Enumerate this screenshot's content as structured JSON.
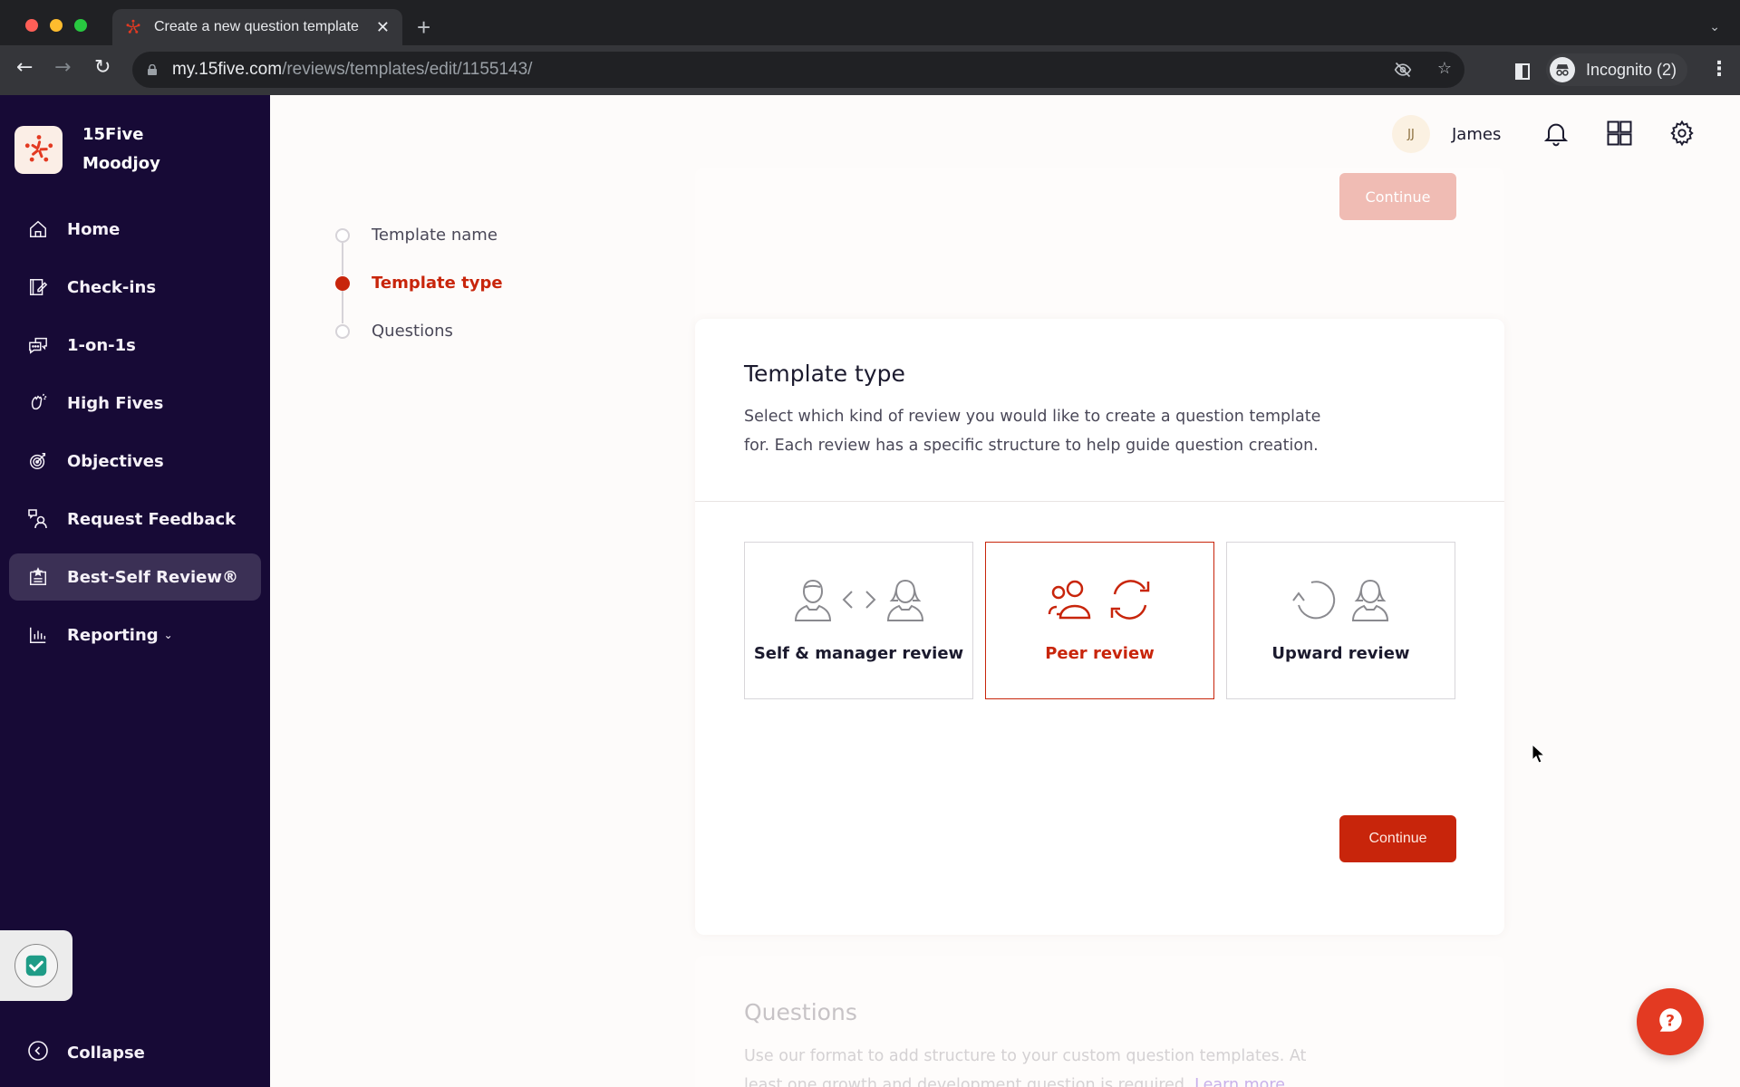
{
  "browser": {
    "tab_title": "Create a new question template",
    "url_host": "my.15five.com",
    "url_path": "/reviews/templates/edit/1155143/",
    "incognito_label": "Incognito (2)"
  },
  "sidebar": {
    "org_name_line1": "15Five",
    "org_name_line2": "Moodjoy",
    "items": [
      {
        "label": "Home",
        "icon": "home-icon"
      },
      {
        "label": "Check-ins",
        "icon": "edit-note-icon"
      },
      {
        "label": "1-on-1s",
        "icon": "chat-bubbles-icon"
      },
      {
        "label": "High Fives",
        "icon": "high-five-icon"
      },
      {
        "label": "Objectives",
        "icon": "target-icon"
      },
      {
        "label": "Request Feedback",
        "icon": "request-feedback-icon"
      },
      {
        "label": "Best-Self Review®",
        "icon": "review-clipboard-icon",
        "active": true
      },
      {
        "label": "Reporting",
        "icon": "bar-chart-icon",
        "has_dropdown": true
      }
    ],
    "collapse_label": "Collapse"
  },
  "header": {
    "avatar_initials": "JJ",
    "user_name": "James"
  },
  "stepper": {
    "steps": [
      {
        "label": "Template name",
        "state": "pending"
      },
      {
        "label": "Template type",
        "state": "active"
      },
      {
        "label": "Questions",
        "state": "pending"
      }
    ]
  },
  "top_card": {
    "continue_label": "Continue"
  },
  "template_type_card": {
    "title": "Template type",
    "description": "Select which kind of review you would like to create a question template for. Each review has a specific structure to help guide question creation.",
    "options": [
      {
        "label": "Self & manager review",
        "selected": false
      },
      {
        "label": "Peer review",
        "selected": true
      },
      {
        "label": "Upward review",
        "selected": false
      }
    ],
    "continue_label": "Continue"
  },
  "questions_card": {
    "title": "Questions",
    "description": "Use our format to add structure to your custom question templates. At least one growth and development question is required.",
    "link_label": "Learn more"
  },
  "colors": {
    "accent": "#c8250b",
    "sidebar_bg": "#170a36",
    "sidebar_active": "#3b3055",
    "help_button": "#e33a22"
  }
}
